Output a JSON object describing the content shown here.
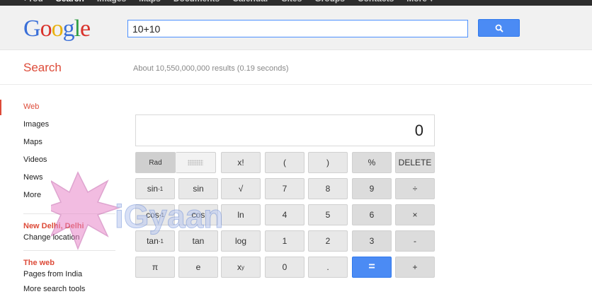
{
  "topnav": {
    "items": [
      "+You",
      "Search",
      "Images",
      "Maps",
      "Documents",
      "Calendar",
      "Sites",
      "Groups",
      "Contacts",
      "More ▾"
    ],
    "active_index": 1
  },
  "header": {
    "logo_text": "Google",
    "search_value": "10+10"
  },
  "subheader": {
    "title": "Search",
    "stats": "About 10,550,000,000 results (0.19 seconds)"
  },
  "sidebar": {
    "items": [
      "Web",
      "Images",
      "Maps",
      "Videos",
      "News",
      "More"
    ],
    "active_index": 0,
    "location_heading": "New Delhi, Delhi",
    "location_action": "Change location",
    "web_heading": "The web",
    "web_option": "Pages from India",
    "more_tools": "More search tools"
  },
  "calculator": {
    "display": "0",
    "rows": [
      [
        "Rad",
        "",
        "x!",
        "(",
        ")",
        "%",
        "DELETE"
      ],
      [
        "sin-1",
        "sin",
        "√",
        "7",
        "8",
        "9",
        "÷"
      ],
      [
        "cos-1",
        "cos",
        "ln",
        "4",
        "5",
        "6",
        "×"
      ],
      [
        "tan-1",
        "tan",
        "log",
        "1",
        "2",
        "3",
        "-"
      ],
      [
        "π",
        "e",
        "xy",
        "0",
        ".",
        "=",
        "+"
      ]
    ],
    "inverse_base": [
      "sin",
      "cos",
      "tan"
    ],
    "superscript": "-1",
    "power_base": "x",
    "power_exp": "y"
  },
  "colors": {
    "accent_red": "#dd4b39",
    "search_blue": "#4b8bf4",
    "header_bg": "#f1f1f1",
    "topbar_bg": "#2d2d2d"
  },
  "icons": {
    "search_button": "magnifier-icon",
    "watermark": "igyaan-watermark"
  }
}
